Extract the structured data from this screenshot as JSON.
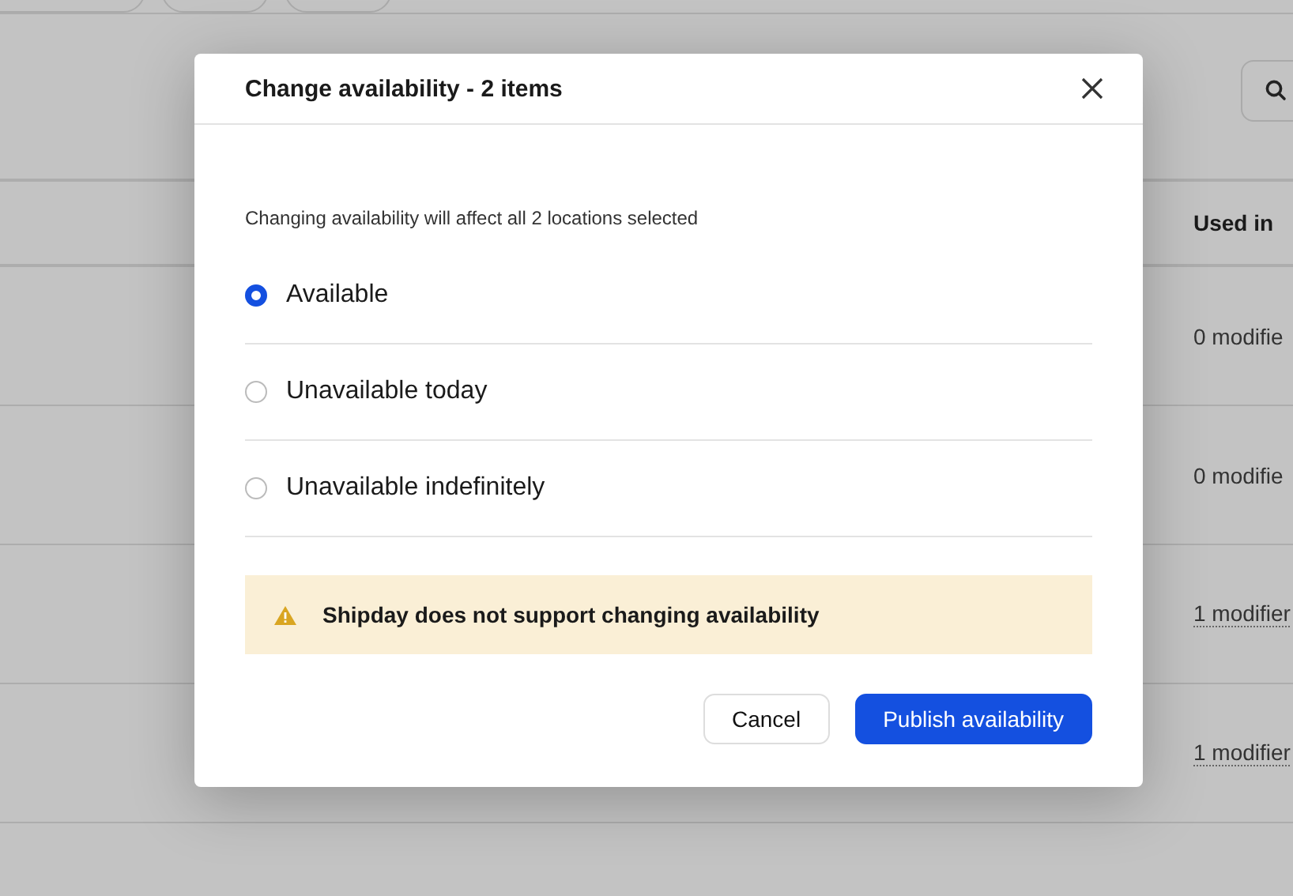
{
  "page": {
    "header": {
      "column_used_in": "Used in"
    },
    "rows": [
      {
        "used_in": "0 modifie",
        "linked": false
      },
      {
        "used_in": "0 modifie",
        "linked": false
      },
      {
        "used_in": "1 modifier",
        "linked": true
      },
      {
        "used_in": "1 modifier",
        "linked": true
      }
    ]
  },
  "dialog": {
    "title": "Change availability - 2 items",
    "subtitle": "Changing availability will affect all 2 locations selected",
    "options": [
      {
        "label": "Available",
        "selected": true
      },
      {
        "label": "Unavailable today",
        "selected": false
      },
      {
        "label": "Unavailable indefinitely",
        "selected": false
      }
    ],
    "warning": "Shipday does not support changing availability",
    "buttons": [
      {
        "label": "Cancel",
        "kind": "secondary"
      },
      {
        "label": "Publish availability",
        "kind": "primary"
      }
    ]
  }
}
